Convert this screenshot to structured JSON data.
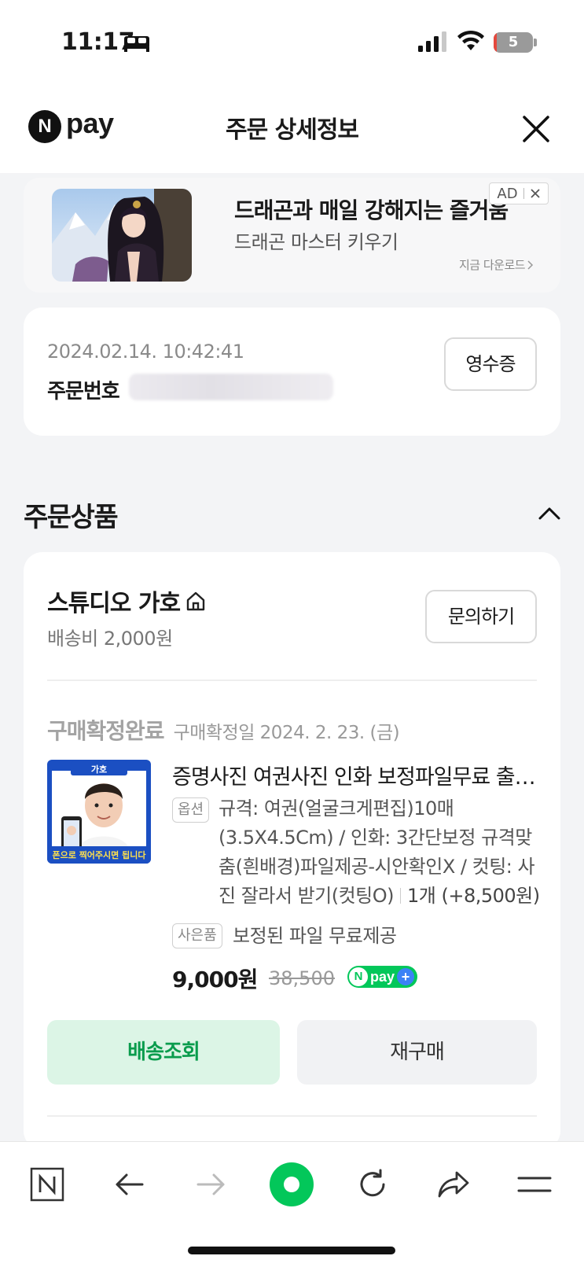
{
  "status_bar": {
    "time": "11:17",
    "battery": "5"
  },
  "header": {
    "logo_text": "pay",
    "logo_badge": "N",
    "title": "주문 상세정보"
  },
  "ad": {
    "title": "드래곤과 매일 강해지는 즐거움",
    "subtitle": "드래곤 마스터 키우기",
    "cta": "지금 다운로드",
    "badge": "AD"
  },
  "order": {
    "date": "2024.02.14. 10:42:41",
    "number_label": "주문번호",
    "receipt_label": "영수증"
  },
  "section": {
    "title": "주문상품"
  },
  "store": {
    "name": "스튜디오 가호",
    "shipping": "배송비 2,000원",
    "inquiry_label": "문의하기"
  },
  "item": {
    "status": "구매확정완료",
    "status_date": "구매확정일 2024. 2. 23. (금)",
    "thumb_top": "가호",
    "thumb_caption": "폰으로 찍어주시면 됩니다",
    "name": "증명사진 여권사진 인화 보정파일무료 출장 촬영",
    "option_tag": "옵션",
    "option_text": "규격: 여권(얼굴크게편집)10매(3.5X4.5Cm) / 인화: 3간단보정 규격맞춤(흰배경)파일제공-시안확인X / 컷팅: 사진 잘라서 받기(컷팅O)",
    "quantity": "1개 (+8,500원)",
    "gift_tag": "사은품",
    "gift_text": "보정된 파일 무료제공",
    "price": "9,000원",
    "original_price": "38,500",
    "npay_plus": {
      "n": "N",
      "text": "pay",
      "plus": "+"
    }
  },
  "actions": {
    "track_label": "배송조회",
    "rebuy_label": "재구매"
  },
  "colors": {
    "brand_green": "#03c75a",
    "track_bg": "#dcf5e6",
    "track_text": "#0a9c4d"
  },
  "toolbar": {
    "items": [
      "naver-n-icon",
      "back-arrow-icon",
      "forward-arrow-icon",
      "green-dot-icon",
      "refresh-icon",
      "share-icon",
      "menu-icon"
    ]
  }
}
